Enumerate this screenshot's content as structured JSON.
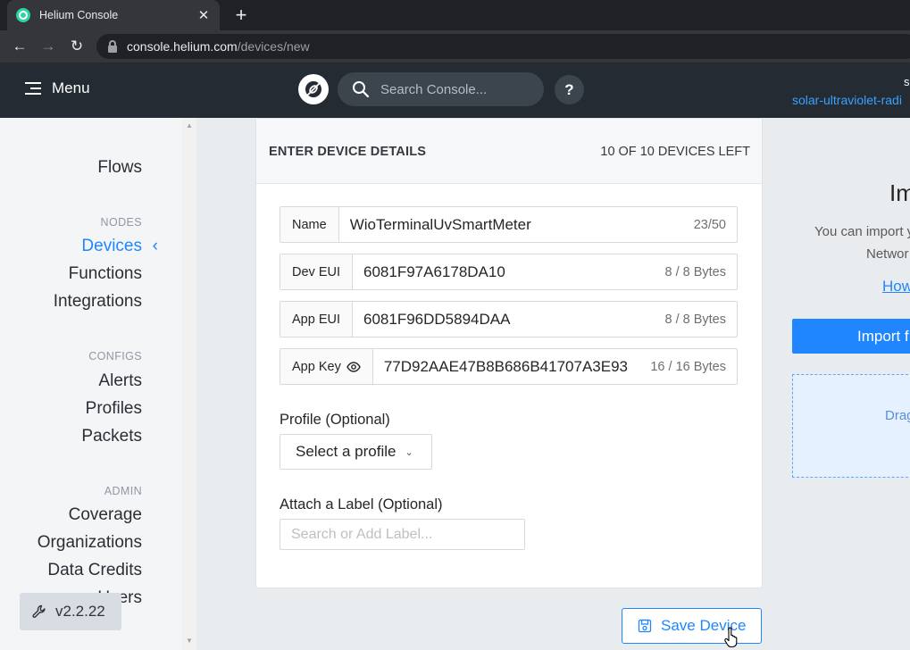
{
  "browser": {
    "tab_title": "Helium Console",
    "tab_close": "✕",
    "new_tab": "+",
    "url_host": "console.helium.com",
    "url_path": "/devices/new"
  },
  "header": {
    "menu_label": "Menu",
    "search_placeholder": "Search Console...",
    "help_label": "?",
    "org_initial": "s",
    "org_name": "solar-ultraviolet-radi"
  },
  "sidebar": {
    "top_item": "Flows",
    "sections": [
      {
        "title": "NODES",
        "items": [
          "Devices",
          "Functions",
          "Integrations"
        ]
      },
      {
        "title": "CONFIGS",
        "items": [
          "Alerts",
          "Profiles",
          "Packets"
        ]
      },
      {
        "title": "ADMIN",
        "items": [
          "Coverage",
          "Organizations",
          "Data Credits",
          "Users"
        ]
      }
    ],
    "active_item": "Devices",
    "version": "v2.2.22"
  },
  "form": {
    "title": "ENTER DEVICE DETAILS",
    "device_count": "10 OF 10 DEVICES LEFT",
    "name": {
      "label": "Name",
      "value": "WioTerminalUvSmartMeter",
      "counter": "23/50"
    },
    "dev_eui": {
      "label": "Dev EUI",
      "value": "6081F97A6178DA10",
      "counter": "8 / 8 Bytes"
    },
    "app_eui": {
      "label": "App EUI",
      "value": "6081F96DD5894DAA",
      "counter": "8 / 8 Bytes"
    },
    "app_key": {
      "label": "App Key",
      "value": "77D92AAE47B8B686B41707A3E93",
      "counter": "16 / 16 Bytes"
    },
    "profile_label": "Profile (Optional)",
    "profile_select": "Select a profile",
    "label_label": "Attach a Label (Optional)",
    "label_placeholder": "Search or Add Label...",
    "save_button": "Save Device"
  },
  "import_panel": {
    "title": "Im",
    "text_line1": "You can import y",
    "text_line2": "Networ",
    "link": "How",
    "button": "Import f",
    "dropzone": "Drag"
  },
  "colors": {
    "accent": "#1f86ff",
    "header_bg": "#242b33",
    "sidebar_bg": "#f4f5f7"
  }
}
